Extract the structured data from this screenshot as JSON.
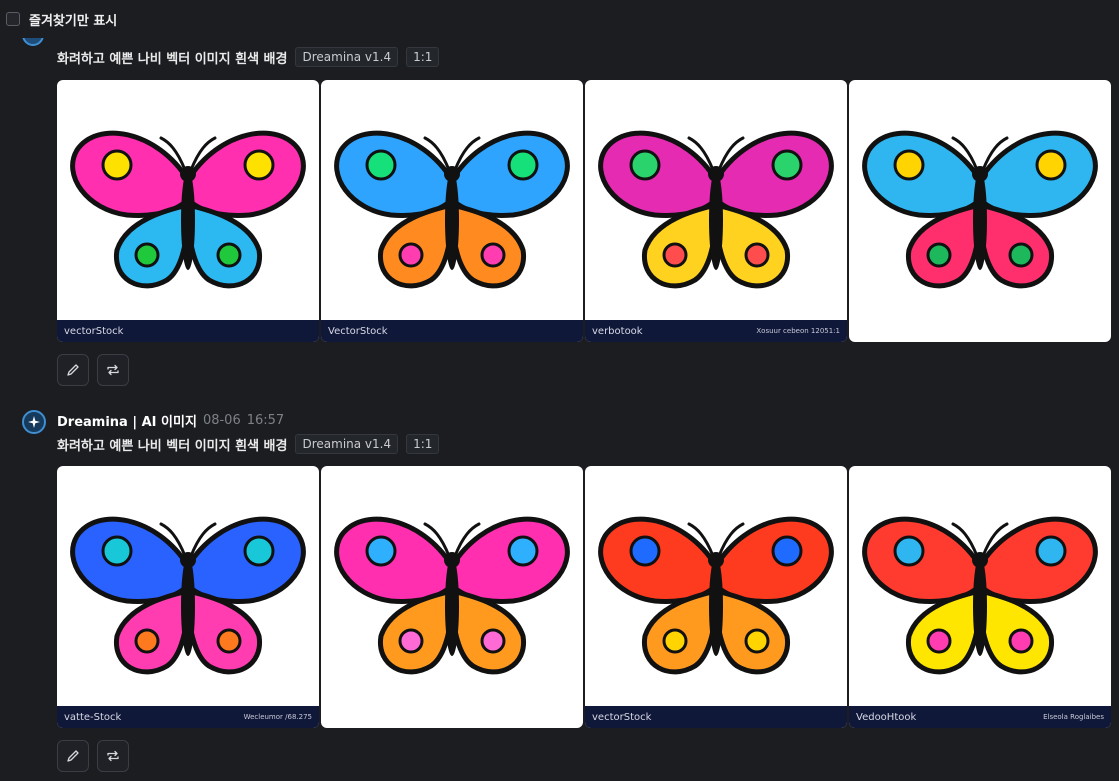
{
  "favorites_filter": {
    "label": "즐겨찾기만 표시"
  },
  "messages": [
    {
      "prompt": "화려하고 예쁜 나비 벡터 이미지 흰색 배경",
      "model_tag": "Dreamina v1.4",
      "ratio_tag": "1:1",
      "images": [
        {
          "watermark_left": "vectorStock",
          "watermark_right": "",
          "body": "#111111",
          "c1": "#ff2fb0",
          "c2": "#2cb8f0",
          "c3": "#ffe100",
          "c4": "#1fc93b"
        },
        {
          "watermark_left": "VectorStock",
          "watermark_right": "",
          "body": "#111111",
          "c1": "#2fa4ff",
          "c2": "#ff8a1f",
          "c3": "#16e07a",
          "c4": "#ff3db0"
        },
        {
          "watermark_left": "verbotook",
          "watermark_right": "Xosuur cebeon 12051:1",
          "body": "#111111",
          "c1": "#e62bb3",
          "c2": "#ffd21f",
          "c3": "#2ad36b",
          "c4": "#ff4d4d"
        },
        {
          "watermark_left": "",
          "watermark_right": "",
          "body": "#111111",
          "c1": "#2fb6f0",
          "c2": "#ff2f6e",
          "c3": "#ffd400",
          "c4": "#1db85c"
        }
      ]
    },
    {
      "sender": "Dreamina | AI 이미지",
      "timestamp_date": "08-06",
      "timestamp_time": "16:57",
      "prompt": "화려하고 예쁜 나비 벡터 이미지 흰색 배경",
      "model_tag": "Dreamina v1.4",
      "ratio_tag": "1:1",
      "images": [
        {
          "watermark_left": "vatte-Stock",
          "watermark_right": "Wecleumor /68.275",
          "body": "#111111",
          "c1": "#2a62ff",
          "c2": "#ff3db0",
          "c3": "#18c7d8",
          "c4": "#ff7a1f"
        },
        {
          "watermark_left": "",
          "watermark_right": "",
          "body": "#111111",
          "c1": "#ff2fb0",
          "c2": "#ff9a1f",
          "c3": "#2fb0ff",
          "c4": "#ff6ad5"
        },
        {
          "watermark_left": "vectorStock",
          "watermark_right": "",
          "body": "#111111",
          "c1": "#ff3b1f",
          "c2": "#ff9a1f",
          "c3": "#1f6bff",
          "c4": "#ffd400"
        },
        {
          "watermark_left": "VedooHtook",
          "watermark_right": "Elseola Roglaibes",
          "body": "#111111",
          "c1": "#ff3b2f",
          "c2": "#ffe600",
          "c3": "#2fb6f0",
          "c4": "#ff3db0"
        }
      ]
    }
  ],
  "icons": {
    "edit": "pencil-icon",
    "regenerate": "repeat-icon",
    "avatar": "sparkle-icon"
  }
}
